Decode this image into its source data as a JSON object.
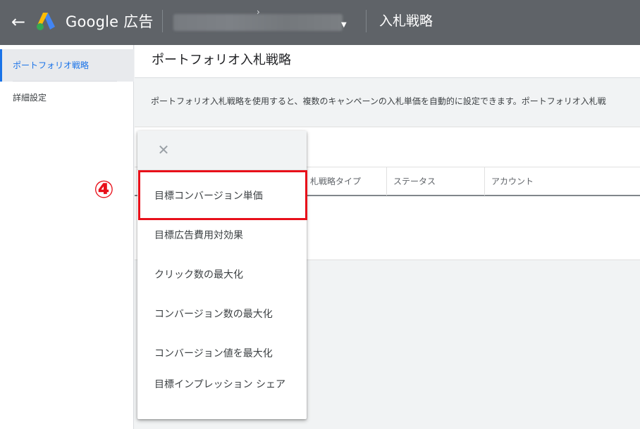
{
  "header": {
    "back_icon": "arrow-back-icon",
    "logo_icon": "google-ads-logo-icon",
    "brand": "Google 広告",
    "account_chevron": "›",
    "dropdown_icon": "caret-down-icon",
    "page_name": "入札戦略",
    "colors": {
      "bar": "#5f6368",
      "text": "#ffffff"
    }
  },
  "sidebar": {
    "items": [
      {
        "label": "ポートフォリオ戦略",
        "active": true
      },
      {
        "label": "詳細設定",
        "active": false
      }
    ],
    "accent": "#1a73e8"
  },
  "main": {
    "title": "ポートフォリオ入札戦略",
    "description": "ポートフォリオ入札戦略を使用すると、複数のキャンペーンの入札単価を自動的に設定できます。ポートフォリオ入札戦",
    "table": {
      "columns": [
        "札戦略タイプ",
        "ステータス",
        "アカウント"
      ]
    }
  },
  "menu": {
    "close_icon": "close-icon",
    "options": [
      "目標コンバージョン単価",
      "目標広告費用対効果",
      "クリック数の最大化",
      "コンバージョン数の最大化",
      "コンバージョン値を最大化",
      "目標インプレッション シェア"
    ],
    "highlight_color": "#e8101a"
  },
  "annotation": {
    "step_marker": "④"
  }
}
